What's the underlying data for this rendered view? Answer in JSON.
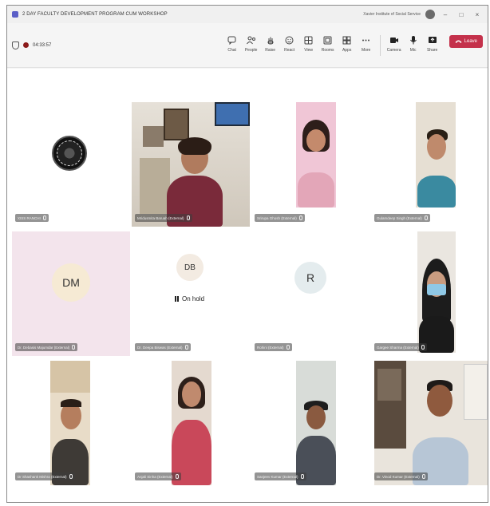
{
  "titlebar": {
    "title": "2 DAY FACULTY DEVELOPMENT PROGRAM CUM WORKSHOP",
    "org": "Xavier Institute of Social Service",
    "minimize": "–",
    "maximize": "□",
    "close": "×"
  },
  "toolbar": {
    "timer": "04:33:57",
    "actions": [
      {
        "label": "Chat",
        "icon": "chat-icon"
      },
      {
        "label": "People",
        "icon": "people-icon"
      },
      {
        "label": "Raise",
        "icon": "raise-hand-icon"
      },
      {
        "label": "React",
        "icon": "react-icon"
      },
      {
        "label": "View",
        "icon": "view-icon"
      },
      {
        "label": "Rooms",
        "icon": "rooms-icon"
      },
      {
        "label": "Apps",
        "icon": "apps-icon"
      },
      {
        "label": "More",
        "icon": "more-icon"
      }
    ],
    "devices": [
      {
        "label": "Camera",
        "icon": "camera-icon"
      },
      {
        "label": "Mic",
        "icon": "mic-icon"
      },
      {
        "label": "Share",
        "icon": "share-icon"
      }
    ],
    "leave_label": "Leave"
  },
  "participants": [
    {
      "name": "XISS RANCHI",
      "kind": "logo"
    },
    {
      "name": "Mridusmita Baruah (External)",
      "kind": "video"
    },
    {
      "name": "Srirupa Ghosh (External)",
      "kind": "video"
    },
    {
      "name": "Gulamdeep Singh (External)",
      "kind": "video"
    },
    {
      "name": "Dr. Debasis Majumdar (External)",
      "kind": "initials",
      "initials": "DM"
    },
    {
      "name": "Dr. Deepa Biswas (External)",
      "kind": "initials",
      "initials": "DB",
      "status": "On hold"
    },
    {
      "name": "Rohini (External)",
      "kind": "initials",
      "initials": "R"
    },
    {
      "name": "Gargee Sharma (External)",
      "kind": "video"
    },
    {
      "name": "Dr Shashank Mishra (External)",
      "kind": "video"
    },
    {
      "name": "Anjali Sinha (External)",
      "kind": "video"
    },
    {
      "name": "Sanjeev Kumar (External)",
      "kind": "video"
    },
    {
      "name": "Dr. Vinod Kumar (External)",
      "kind": "video"
    }
  ],
  "colors": {
    "accent": "#5b5fc7",
    "leave": "#c4314b",
    "tile_pink": "#f3e4ec"
  }
}
